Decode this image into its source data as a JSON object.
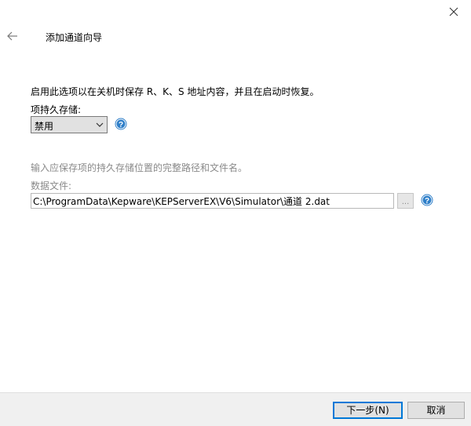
{
  "window": {
    "title": "添加通道向导"
  },
  "description": "启用此选项以在关机时保存 R、K、S 地址内容，并且在启动时恢复。",
  "persist": {
    "label": "项持久存储:",
    "selected": "禁用"
  },
  "hint": "输入应保存项的持久存储位置的完整路径和文件名。",
  "datafile": {
    "label": "数据文件:",
    "value": "C:\\ProgramData\\Kepware\\KEPServerEX\\V6\\Simulator\\通道 2.dat",
    "browse_label": "..."
  },
  "footer": {
    "next_label": "下一步(N)",
    "cancel_label": "取消"
  },
  "icons": {
    "close": "close-icon",
    "back": "arrow-left-icon",
    "help": "help-icon",
    "dropdown": "chevron-down-icon"
  },
  "colors": {
    "accent": "#0078d7",
    "help_blue": "#2f7fc9",
    "disabled_text": "#8a8a8a"
  }
}
